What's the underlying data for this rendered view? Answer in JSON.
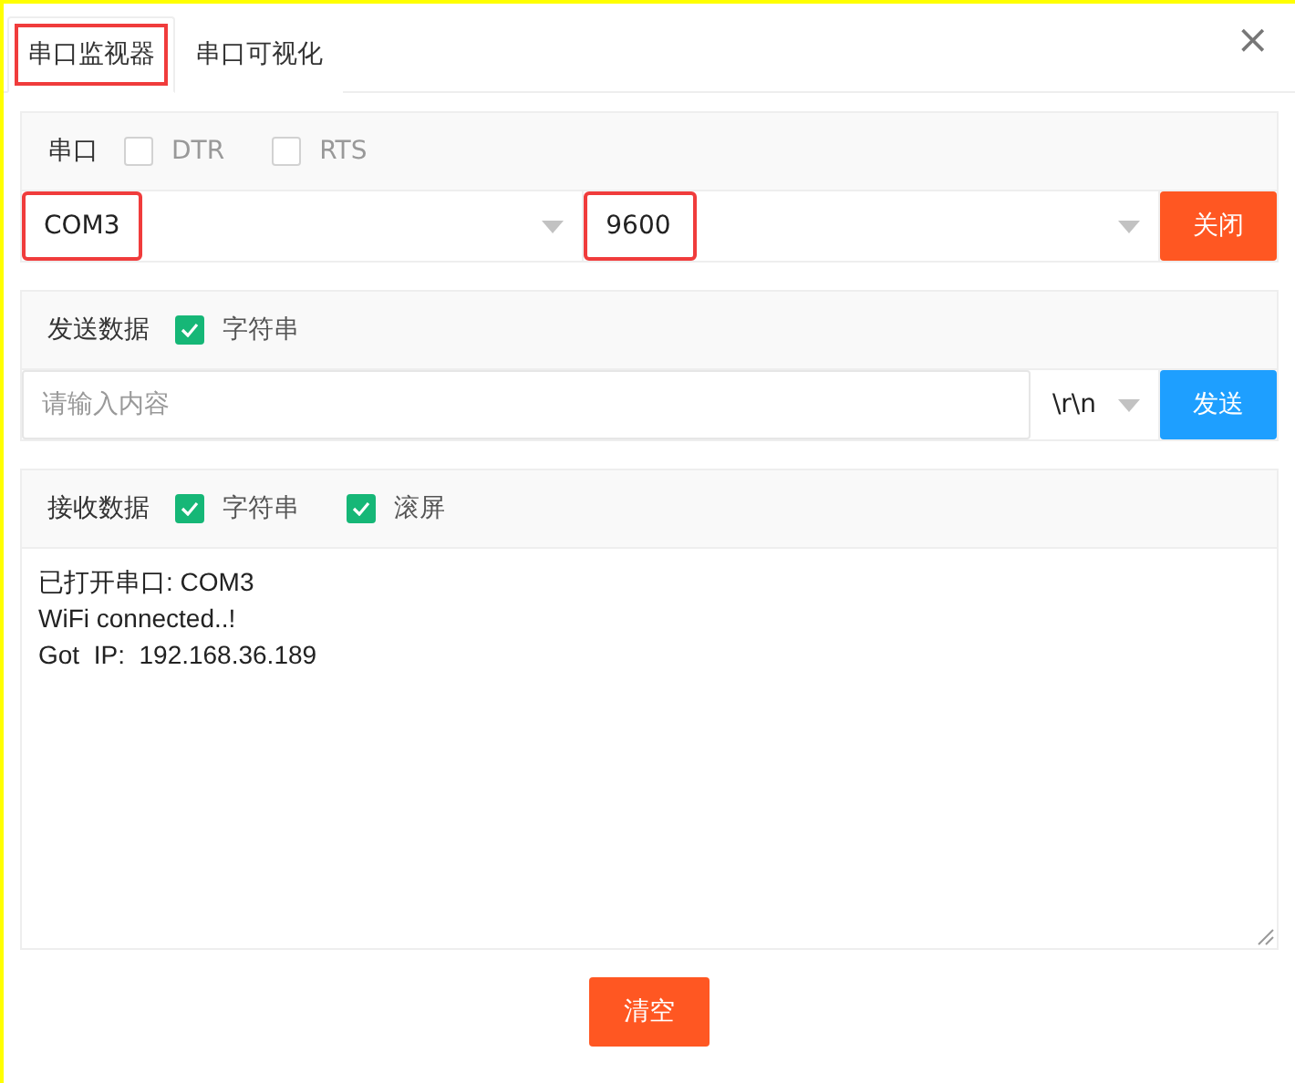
{
  "tabs": [
    {
      "label": "串口监视器",
      "selected": true,
      "highlighted": true
    },
    {
      "label": "串口可视化",
      "selected": false,
      "highlighted": false
    }
  ],
  "close_icon": "×",
  "serial": {
    "label": "串口",
    "options": [
      {
        "label": "DTR",
        "checked": false
      },
      {
        "label": "RTS",
        "checked": false
      }
    ],
    "port": {
      "value": "COM3",
      "highlighted": true
    },
    "baud": {
      "value": "9600",
      "highlighted": true
    },
    "button": "关闭"
  },
  "send": {
    "label": "发送数据",
    "options": [
      {
        "label": "字符串",
        "checked": true
      }
    ],
    "input": {
      "placeholder": "请输入内容"
    },
    "line_ending": "\\r\\n",
    "button": "发送"
  },
  "receive": {
    "label": "接收数据",
    "options": [
      {
        "label": "字符串",
        "checked": true
      },
      {
        "label": "滚屏",
        "checked": true
      }
    ],
    "lines": [
      "已打开串口: COM3",
      "WiFi connected..!",
      "Got  IP:  192.168.36.189"
    ]
  },
  "clear_button": "清空"
}
